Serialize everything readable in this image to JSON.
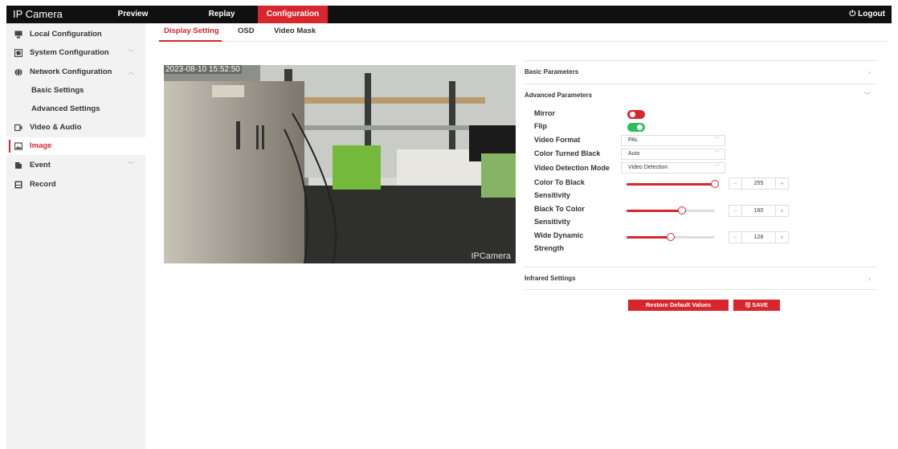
{
  "app": {
    "title": "IP Camera",
    "logout_label": "Logout",
    "accent_color": "#d7262e"
  },
  "nav": {
    "tabs": [
      {
        "label": "Preview"
      },
      {
        "label": "Replay"
      },
      {
        "label": "Configuration",
        "active": true
      }
    ]
  },
  "sidebar": {
    "items": [
      {
        "label": "Local Configuration",
        "icon": "monitor-icon"
      },
      {
        "label": "System Configuration",
        "icon": "system-icon",
        "chevron": "﹀"
      },
      {
        "label": "Network Configuration",
        "icon": "globe-icon",
        "chevron": "︿"
      },
      {
        "label": "Basic Settings"
      },
      {
        "label": "Advanced Settings"
      },
      {
        "label": "Video & Audio",
        "icon": "video-audio-icon"
      },
      {
        "label": "Image",
        "icon": "image-icon",
        "active": true
      },
      {
        "label": "Event",
        "icon": "event-icon",
        "chevron": "﹀"
      },
      {
        "label": "Record",
        "icon": "record-icon"
      }
    ]
  },
  "subtabs": [
    {
      "label": "Display Setting",
      "active": true
    },
    {
      "label": "OSD"
    },
    {
      "label": "Video Mask"
    }
  ],
  "video": {
    "timestamp": "2023-08-10 15:52:50",
    "watermark": "IPCamera"
  },
  "panel": {
    "basic_parameters": "Basic Parameters",
    "advanced_parameters": "Advanced Parameters",
    "infrared_settings": "Infrared Settings",
    "mirror": {
      "label": "Mirror",
      "on": false
    },
    "flip": {
      "label": "Flip",
      "on": true
    },
    "video_format": {
      "label": "Video Format",
      "value": "PAL"
    },
    "color_turned_black": {
      "label": "Color Turned Black",
      "value": "Auto"
    },
    "video_detection_mode": {
      "label": "Video Detection Mode",
      "value": "Video Detection"
    },
    "color_to_black": {
      "label_line1": "Color To Black",
      "label_line2": "Sensitivity",
      "value": "255",
      "fraction": 1.0
    },
    "black_to_color": {
      "label_line1": "Black To Color",
      "label_line2": "Sensitivity",
      "value": "160",
      "fraction": 0.63
    },
    "wide_dynamic": {
      "label_line1": "Wide Dynamic",
      "label_line2": "Strength",
      "value": "128",
      "fraction": 0.5
    },
    "restore_label": "Restore Default Values",
    "save_label": "SAVE"
  },
  "colors": {
    "toggle_off": "#d7262e",
    "toggle_on": "#2bbd5a"
  }
}
